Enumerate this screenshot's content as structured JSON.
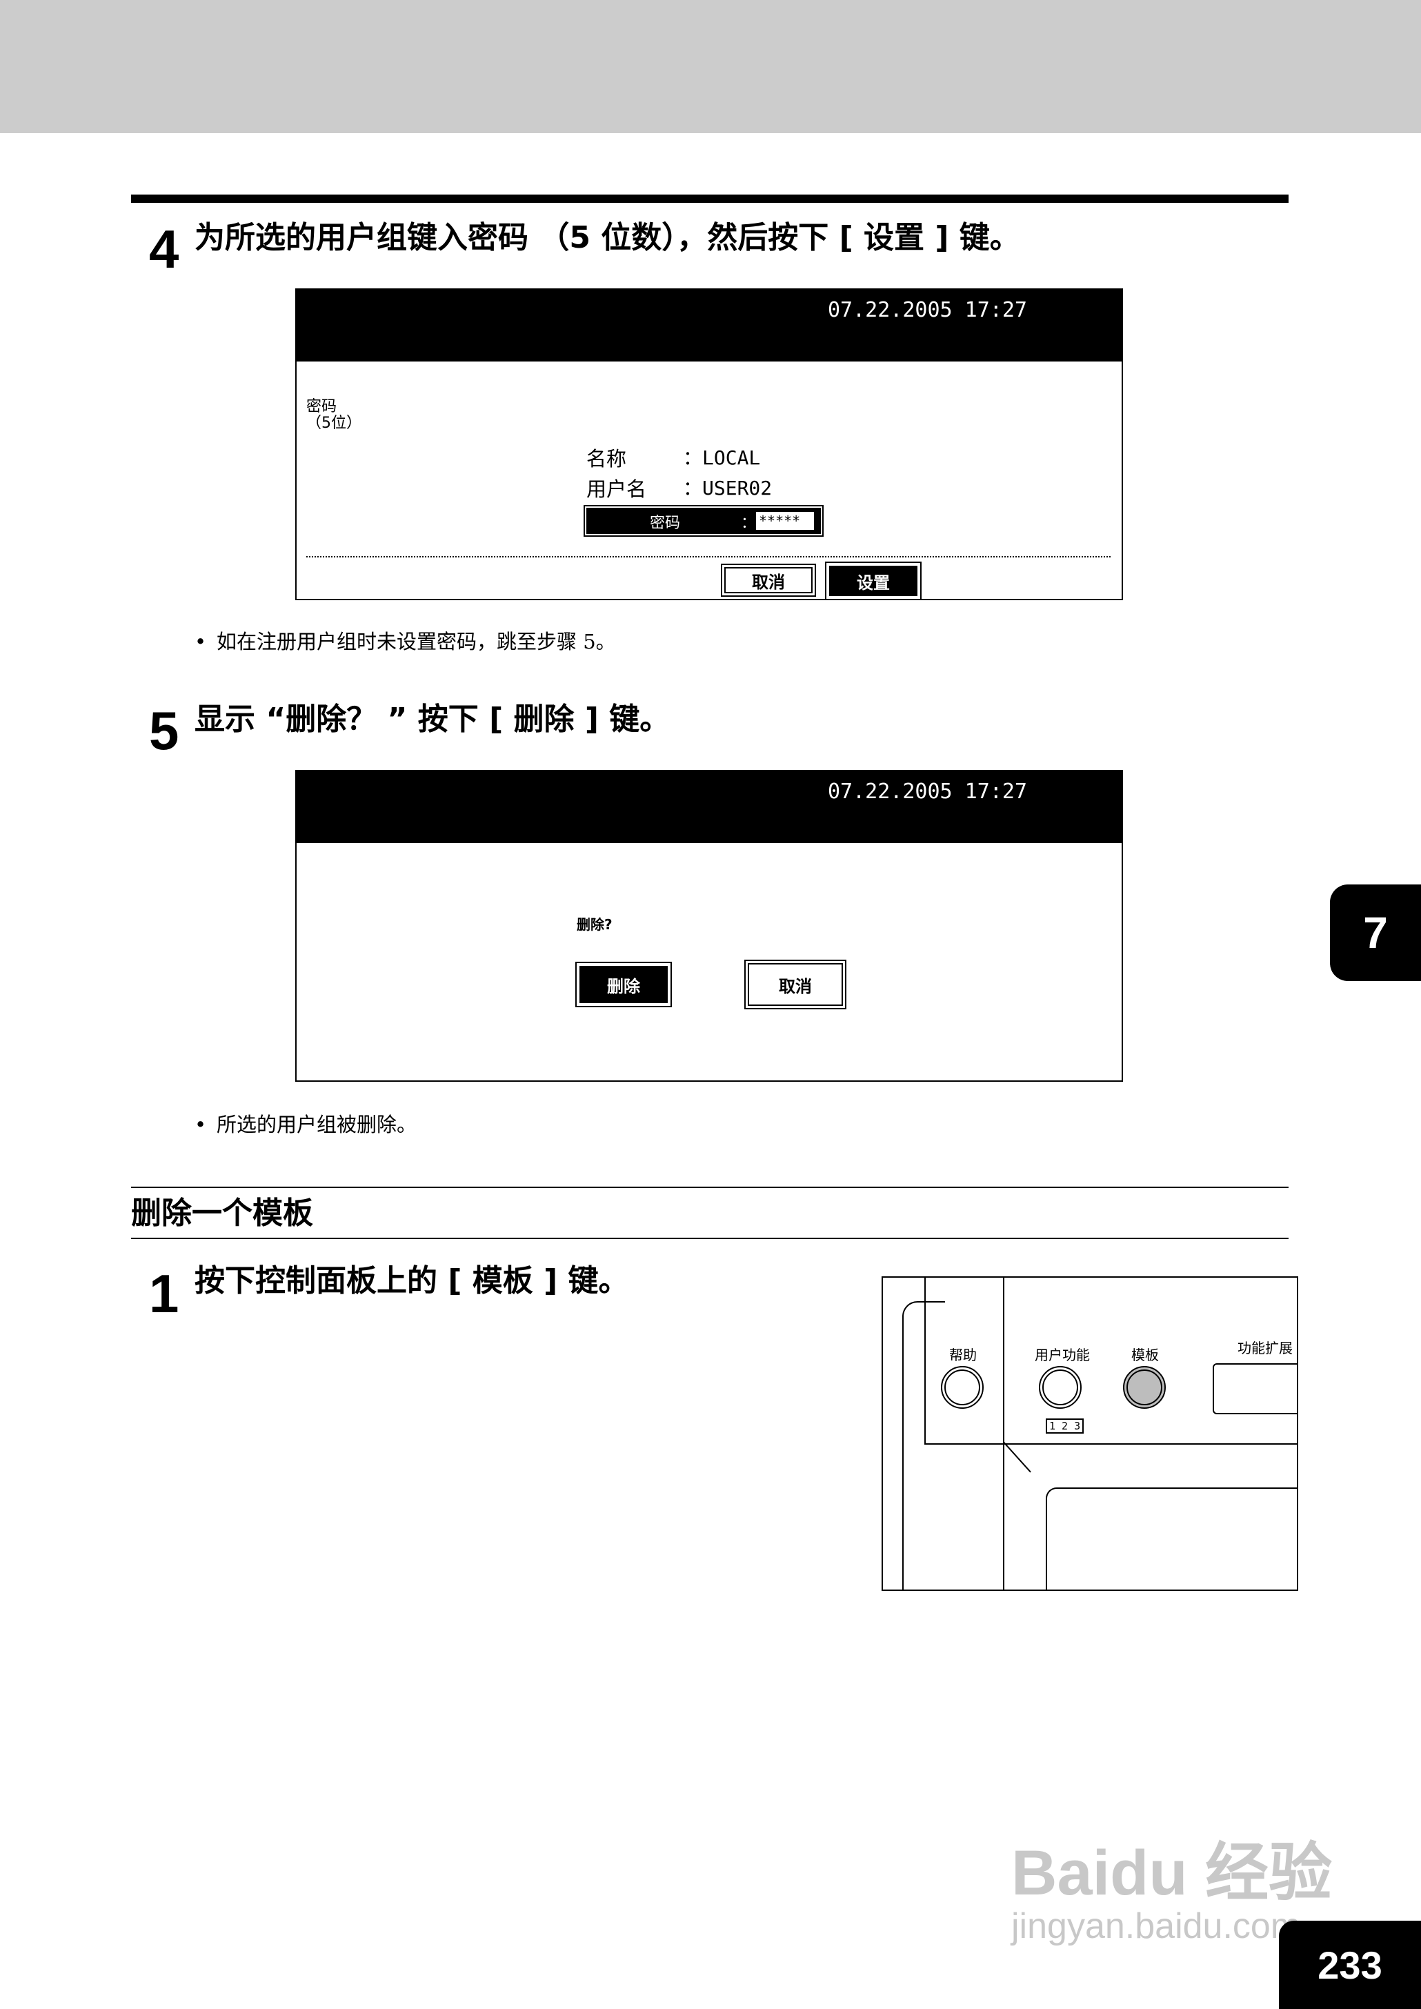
{
  "step4": {
    "number": "4",
    "text": "为所选的用户组键入密码 （5 位数），然后按下 [ 设置 ] 键。",
    "screen": {
      "timestamp": "07.22.2005 17:27",
      "left_label_line1": "密码",
      "left_label_line2": "（5位）",
      "name_label": "名称",
      "name_value": "：LOCAL",
      "user_label": "用户名",
      "user_value": "：USER02",
      "password_label": "密码",
      "password_colon": "：",
      "password_value": "*****",
      "cancel_button": "取消",
      "set_button": "设置"
    },
    "note": "如在注册用户组时未设置密码，跳至步骤 5。"
  },
  "step5": {
    "number": "5",
    "text": "显示 “删除？ ” 按下 [ 删除 ] 键。",
    "screen": {
      "timestamp": "07.22.2005 17:27",
      "prompt": "删除?",
      "delete_button": "删除",
      "cancel_button": "取消"
    },
    "note": "所选的用户组被删除。"
  },
  "section": {
    "title": "删除一个模板"
  },
  "step1": {
    "number": "1",
    "text": "按下控制面板上的 [ 模板 ] 键。",
    "panel": {
      "help_label": "帮助",
      "user_function_label": "用户功能",
      "template_label": "模板",
      "extension_label": "功能扩展",
      "numeric_label": "1 2 3"
    }
  },
  "chapter_tab": "7",
  "page_number": "233",
  "watermark": {
    "brand": "Baidu 经验",
    "url": "jingyan.baidu.com"
  }
}
